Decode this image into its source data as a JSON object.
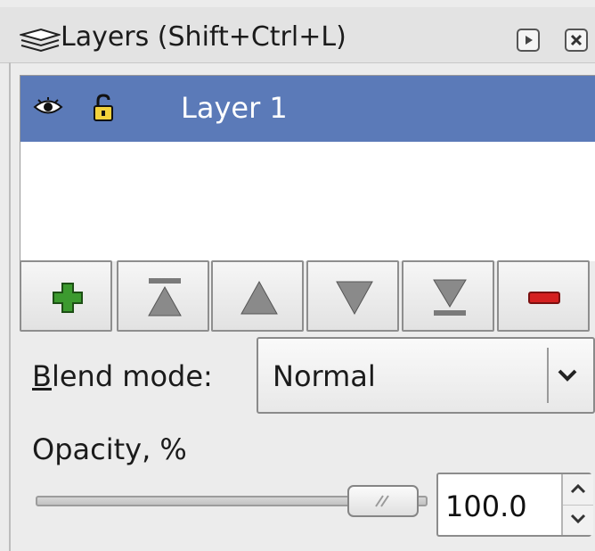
{
  "panel": {
    "title": "Layers (Shift+Ctrl+L)",
    "title_icon": "layers-icon",
    "titlebar_buttons": [
      "dock-icon",
      "close-icon"
    ]
  },
  "layers": {
    "items": [
      {
        "name": "Layer 1",
        "visible": true,
        "locked": false,
        "selected": true
      }
    ]
  },
  "toolbar": {
    "buttons": [
      {
        "name": "add-layer",
        "icon": "plus-icon"
      },
      {
        "name": "raise-to-top",
        "icon": "raise-to-top-icon"
      },
      {
        "name": "raise",
        "icon": "raise-icon"
      },
      {
        "name": "lower",
        "icon": "lower-icon"
      },
      {
        "name": "lower-to-bottom",
        "icon": "lower-to-bottom-icon"
      },
      {
        "name": "delete-layer",
        "icon": "minus-icon"
      }
    ]
  },
  "blend": {
    "label_mnemonic": "B",
    "label_rest": "lend mode:",
    "value": "Normal"
  },
  "opacity": {
    "label": "Opacity, %",
    "value": "100.0",
    "level": 1.0
  },
  "colors": {
    "selection": "#5b7ab8",
    "add": "#3c9a2f",
    "delete": "#d42020"
  }
}
